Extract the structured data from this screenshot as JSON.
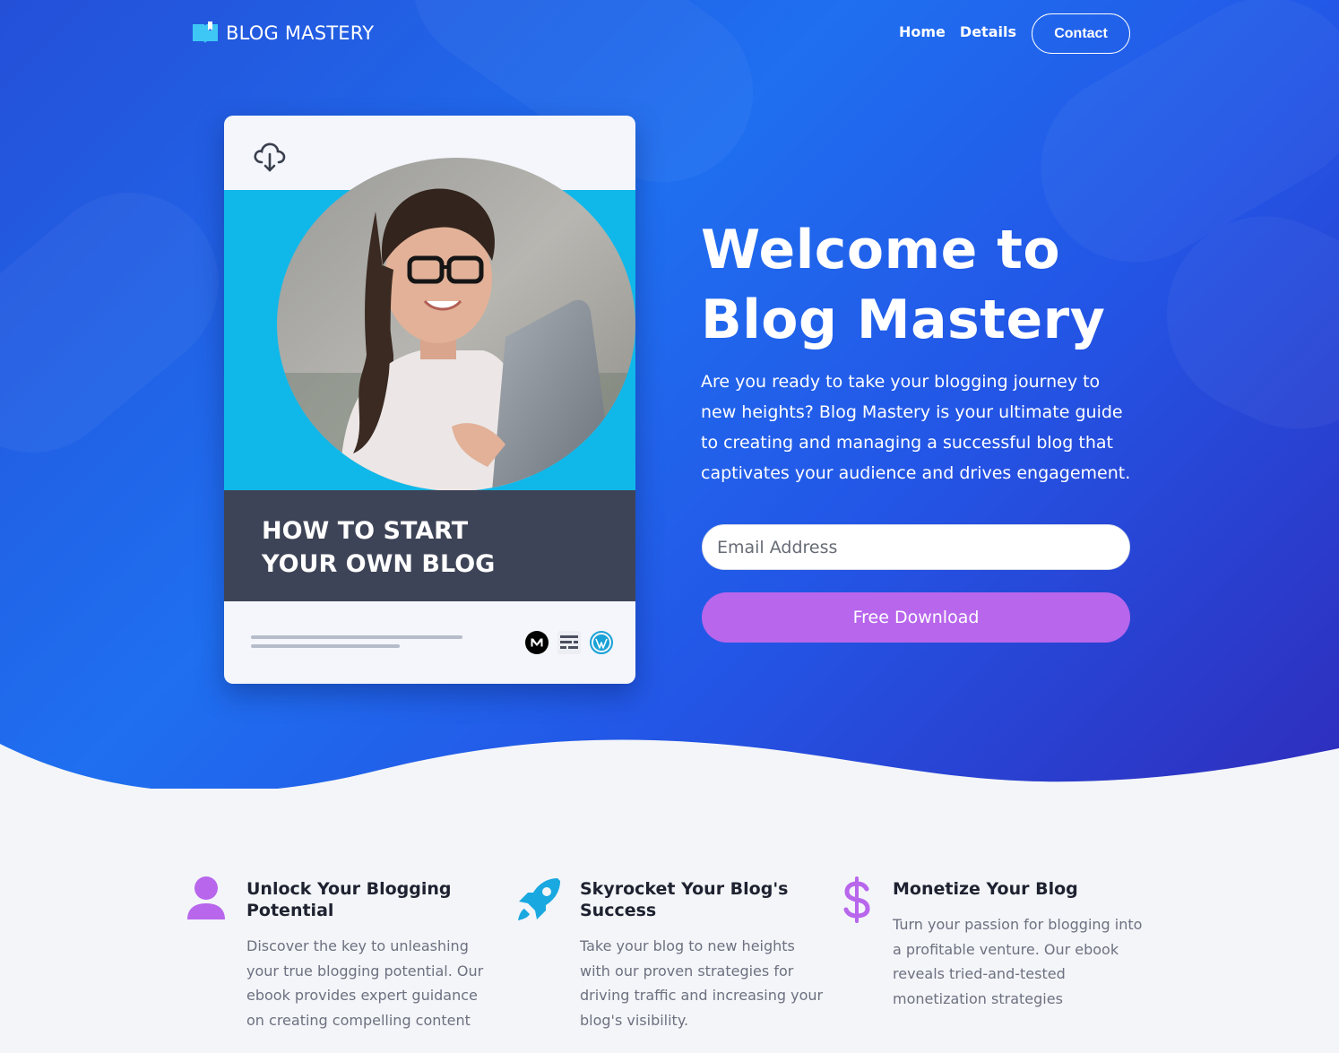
{
  "nav": {
    "logo_text": "BLOG MASTERY",
    "links": [
      "Home",
      "Details"
    ],
    "contact_label": "Contact"
  },
  "book": {
    "title_line1": "HOW TO START",
    "title_line2": "YOUR OWN BLOG",
    "platform_icons": [
      "medium-icon",
      "substack-icon",
      "wordpress-icon"
    ]
  },
  "hero": {
    "title_line1": "Welcome to",
    "title_line2": "Blog Mastery",
    "description": "Are you ready to take your blogging journey to new heights? Blog Mastery is your ultimate guide to creating and managing a successful blog that captivates your audience and drives engagement.",
    "email_placeholder": "Email Address",
    "button_label": "Free Download"
  },
  "features": [
    {
      "icon": "user-icon",
      "title": "Unlock Your Blogging Potential",
      "text": "Discover the key to unleashing your true blogging potential. Our ebook provides expert guidance on creating compelling content"
    },
    {
      "icon": "rocket-icon",
      "title": "Skyrocket Your Blog's Success",
      "text": "Take your blog to new heights with our proven strategies for driving traffic and increasing your blog's visibility."
    },
    {
      "icon": "dollar-icon",
      "title": "Monetize Your Blog",
      "text": "Turn your passion for blogging into a profitable venture. Our ebook reveals tried-and-tested monetization strategies"
    }
  ],
  "colors": {
    "hero_blue": "#1f6ff0",
    "accent_purple": "#b866ec",
    "book_cyan": "#10b8ea",
    "book_dark": "#3e4457",
    "rocket_blue": "#19a8e0"
  }
}
